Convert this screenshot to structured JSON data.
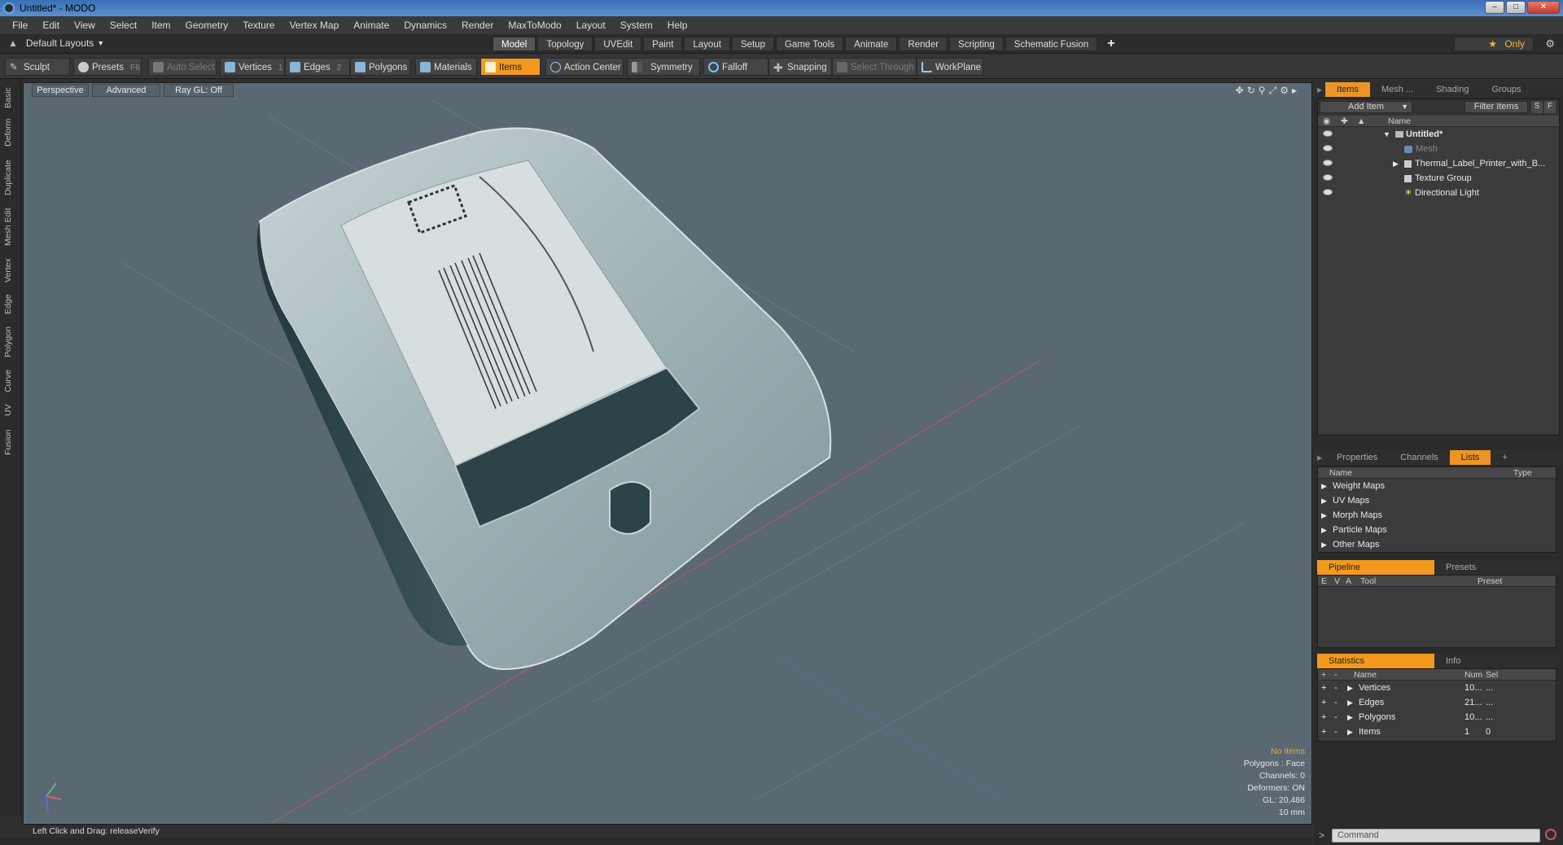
{
  "window": {
    "title": "Untitled* - MODO",
    "controls": [
      "minimize",
      "maximize",
      "close"
    ]
  },
  "menu": [
    "File",
    "Edit",
    "View",
    "Select",
    "Item",
    "Geometry",
    "Texture",
    "Vertex Map",
    "Animate",
    "Dynamics",
    "Render",
    "MaxToModo",
    "Layout",
    "System",
    "Help"
  ],
  "layoutbar": {
    "layout_name": "Default Layouts",
    "tabs": [
      "Model",
      "Topology",
      "UVEdit",
      "Paint",
      "Layout",
      "Setup",
      "Game Tools",
      "Animate",
      "Render",
      "Scripting",
      "Schematic Fusion"
    ],
    "active_tab": "Model",
    "plus": "+",
    "only_label": "Only"
  },
  "toolbar": {
    "sculpt": "Sculpt",
    "presets": "Presets",
    "presets_key": "F6",
    "auto_select": "Auto Select",
    "vertices": "Vertices",
    "vertices_key": "1",
    "edges": "Edges",
    "edges_key": "2",
    "polygons": "Polygons",
    "materials": "Materials",
    "items": "Items",
    "items_key": "5",
    "action_center": "Action Center",
    "symmetry": "Symmetry",
    "falloff": "Falloff",
    "snapping": "Snapping",
    "select_through": "Select Through",
    "workplane": "WorkPlane"
  },
  "left_tabs": [
    "Basic",
    "Deform",
    "Duplicate",
    "Mesh Edit",
    "Vertex",
    "Edge",
    "Polygon",
    "Curve",
    "UV",
    "Fusion"
  ],
  "viewport": {
    "view_mode": "Perspective",
    "advanced": "Advanced",
    "raygl": "Ray GL: Off",
    "stats": {
      "no_items": "No Items",
      "polygons": "Polygons : Face",
      "channels": "Channels: 0",
      "deformers": "Deformers: ON",
      "gl": "GL: 20,486",
      "unit": "10 mm"
    }
  },
  "status": {
    "text": "Left Click and Drag:   releaseVerify"
  },
  "items_panel": {
    "tabs": [
      "Items",
      "Mesh ...",
      "Shading",
      "Groups"
    ],
    "active_tab": "Items",
    "add_item": "Add Item",
    "filter": "Filter Items",
    "s_btn": "S",
    "f_btn": "F",
    "col_name": "Name",
    "tree": [
      {
        "label": "Untitled*",
        "bold": true
      },
      {
        "label": "Mesh",
        "dim": true
      },
      {
        "label": "Thermal_Label_Printer_with_B..."
      },
      {
        "label": "Texture Group"
      },
      {
        "label": "Directional Light"
      }
    ]
  },
  "props_panel": {
    "tabs": [
      "Properties",
      "Channels",
      "Lists"
    ],
    "active_tab": "Lists",
    "plus": "+",
    "col_name": "Name",
    "col_type": "Type",
    "rows": [
      "Weight Maps",
      "UV Maps",
      "Morph Maps",
      "Particle Maps",
      "Other Maps"
    ]
  },
  "pipeline_panel": {
    "tabs": [
      "Pipeline",
      "Presets"
    ],
    "cols": [
      "E",
      "V",
      "A",
      "Tool",
      "Preset"
    ]
  },
  "statistics_panel": {
    "tabs": [
      "Statistics",
      "Info"
    ],
    "cols": [
      "+",
      "-",
      "Name",
      "Num",
      "Sel"
    ],
    "rows": [
      {
        "name": "Vertices",
        "num": "10...",
        "sel": "..."
      },
      {
        "name": "Edges",
        "num": "21...",
        "sel": "..."
      },
      {
        "name": "Polygons",
        "num": "10...",
        "sel": "..."
      },
      {
        "name": "Items",
        "num": "1",
        "sel": "0"
      }
    ]
  },
  "command": {
    "placeholder": "Command"
  },
  "colors": {
    "accent": "#f39a1e",
    "viewport_bg": "#5a6872",
    "panel_bg": "#3b3b3b"
  }
}
